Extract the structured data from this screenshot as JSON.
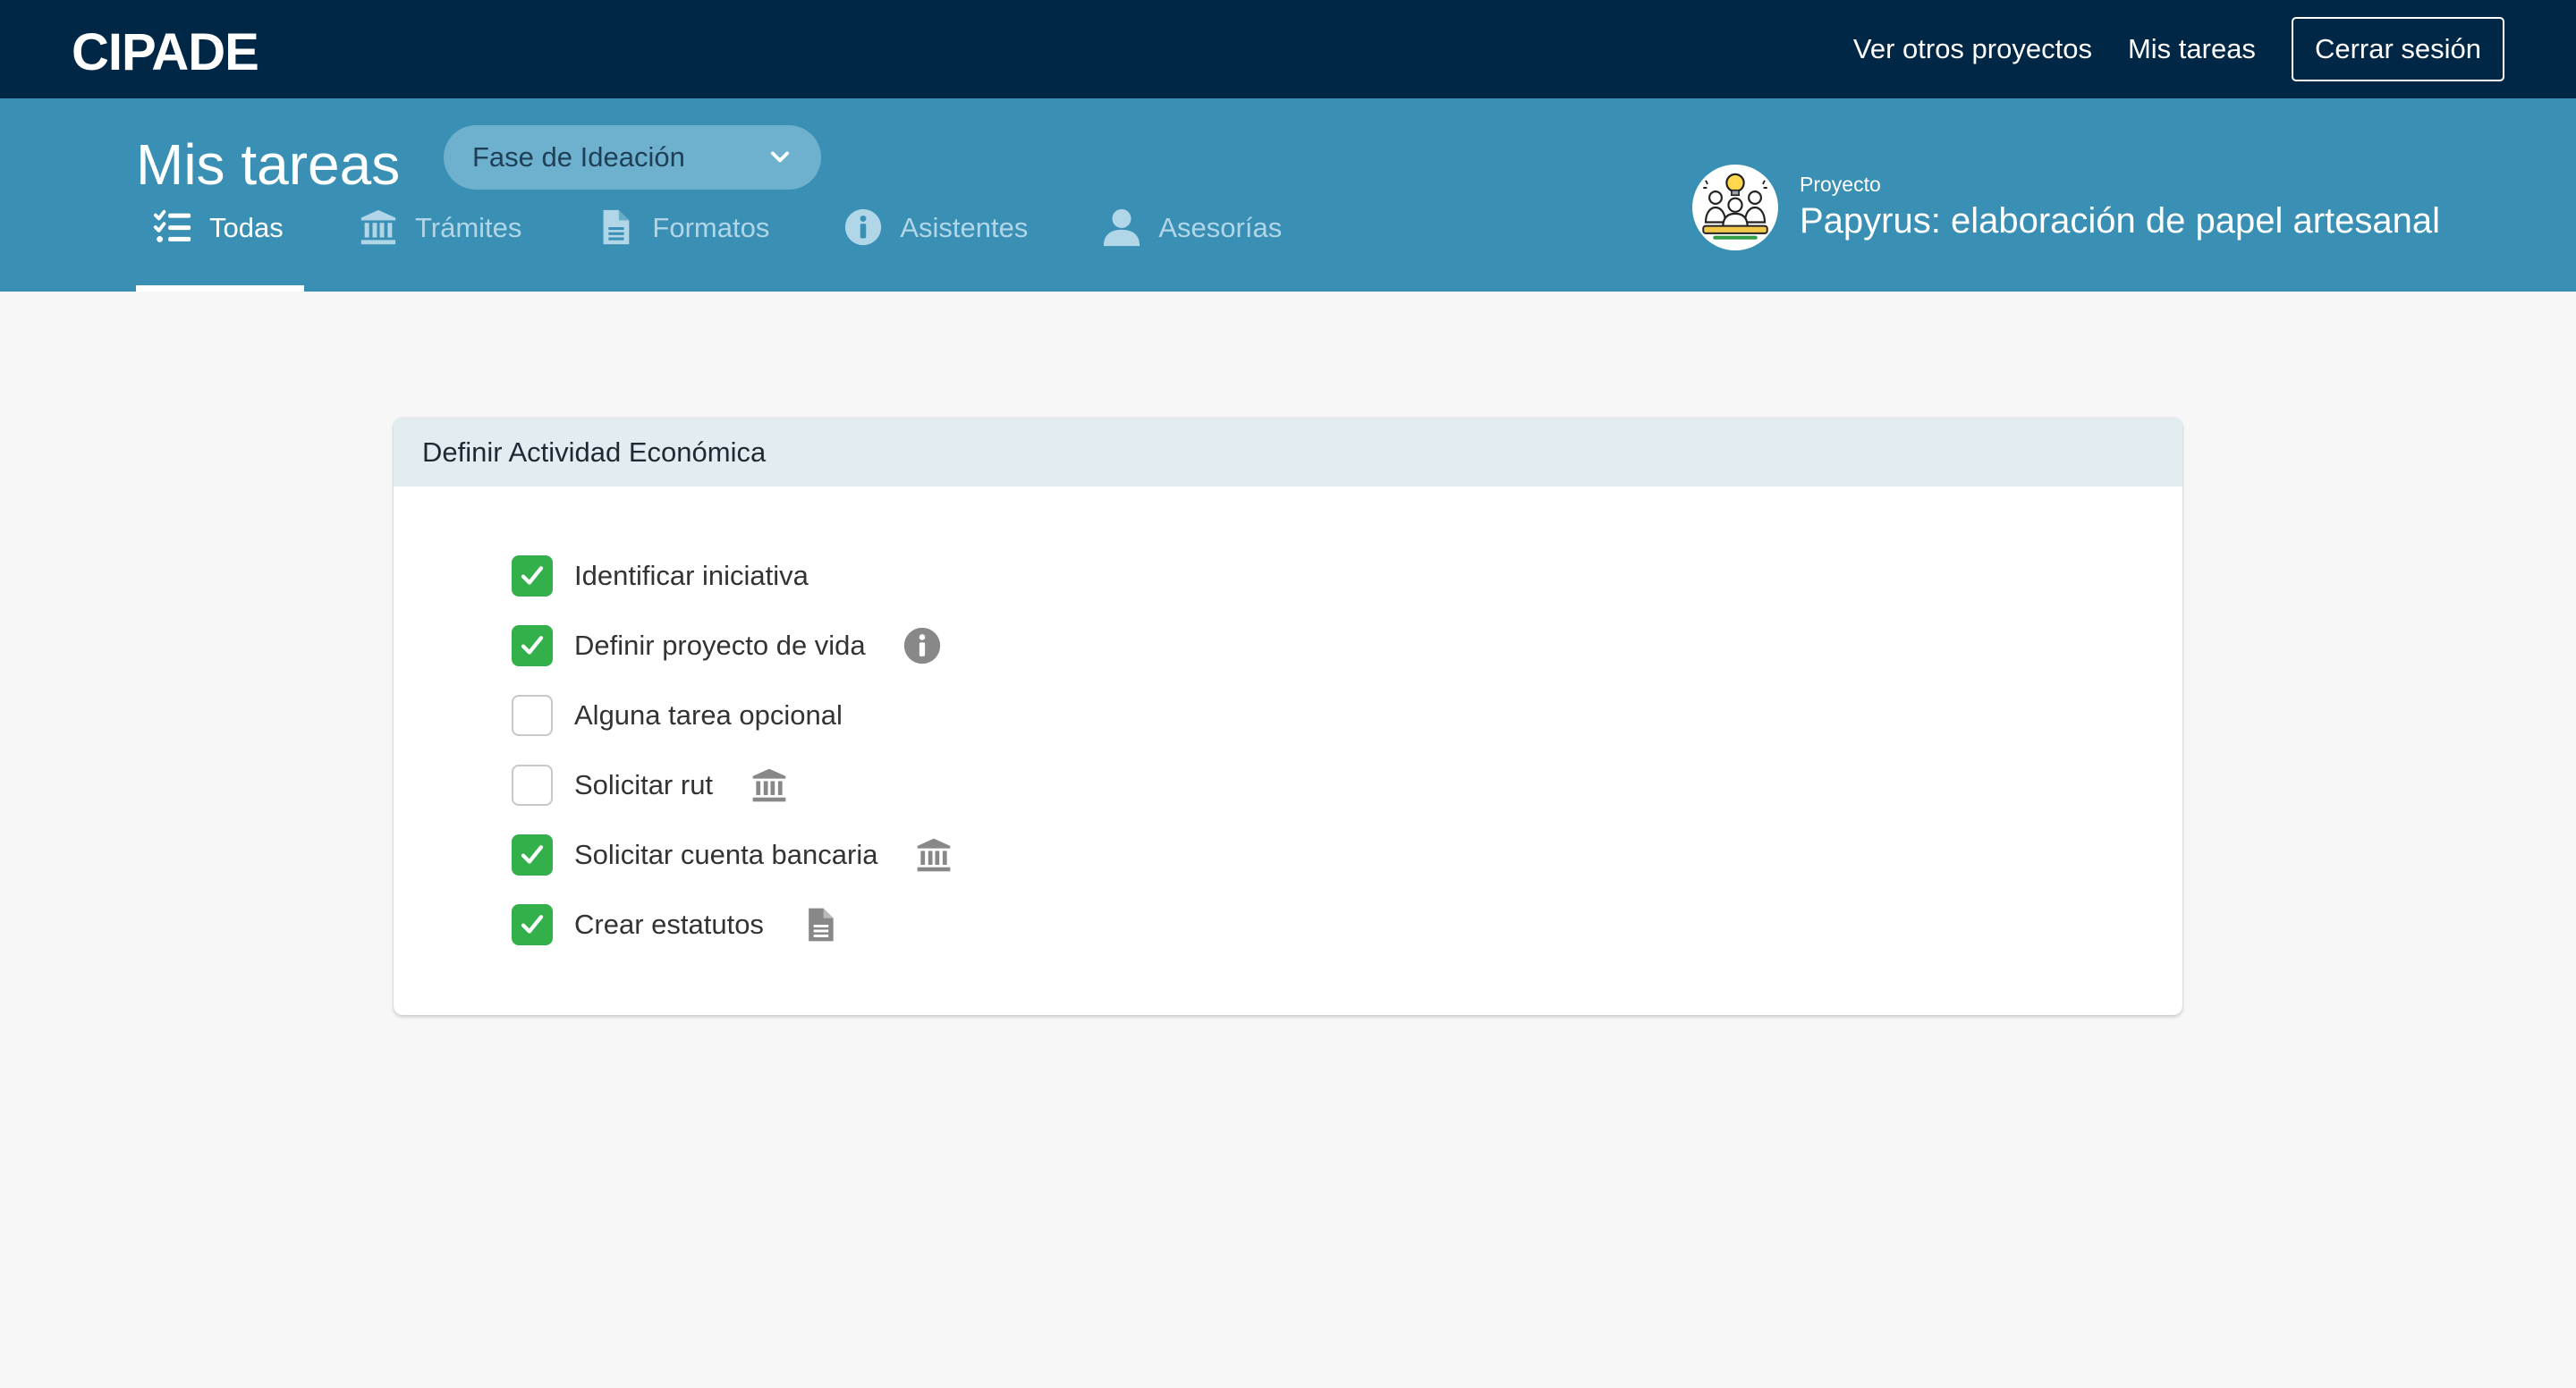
{
  "navbar": {
    "brand": "CIPADE",
    "links": [
      {
        "label": "Ver otros proyectos"
      },
      {
        "label": "Mis tareas"
      }
    ],
    "logout_label": "Cerrar sesión"
  },
  "header": {
    "title": "Mis tareas",
    "phase_select": {
      "value": "Fase de Ideación"
    },
    "tabs": [
      {
        "label": "Todas",
        "icon": "tasks-list-icon",
        "active": true
      },
      {
        "label": "Trámites",
        "icon": "bank-icon",
        "active": false
      },
      {
        "label": "Formatos",
        "icon": "document-icon",
        "active": false
      },
      {
        "label": "Asistentes",
        "icon": "info-icon",
        "active": false
      },
      {
        "label": "Asesorías",
        "icon": "user-icon",
        "active": false
      }
    ],
    "project": {
      "label": "Proyecto",
      "name": "Papyrus: elaboración de papel artesanal",
      "avatar_icon": "team-idea-icon"
    }
  },
  "task_group": {
    "title": "Definir Actividad Económica",
    "tasks": [
      {
        "label": "Identificar iniciativa",
        "checked": true,
        "icon": null
      },
      {
        "label": "Definir proyecto de vida",
        "checked": true,
        "icon": "info-icon"
      },
      {
        "label": "Alguna tarea opcional",
        "checked": false,
        "icon": null
      },
      {
        "label": "Solicitar rut",
        "checked": false,
        "icon": "bank-icon"
      },
      {
        "label": "Solicitar cuenta bancaria",
        "checked": true,
        "icon": "bank-icon"
      },
      {
        "label": "Crear estatutos",
        "checked": true,
        "icon": "document-icon"
      }
    ]
  },
  "colors": {
    "navbar_bg": "#002745",
    "subheader_bg": "#3a8fb4",
    "check_green": "#33b04a",
    "card_header_bg": "#e2ecf1",
    "page_bg": "#f7f7f7"
  }
}
